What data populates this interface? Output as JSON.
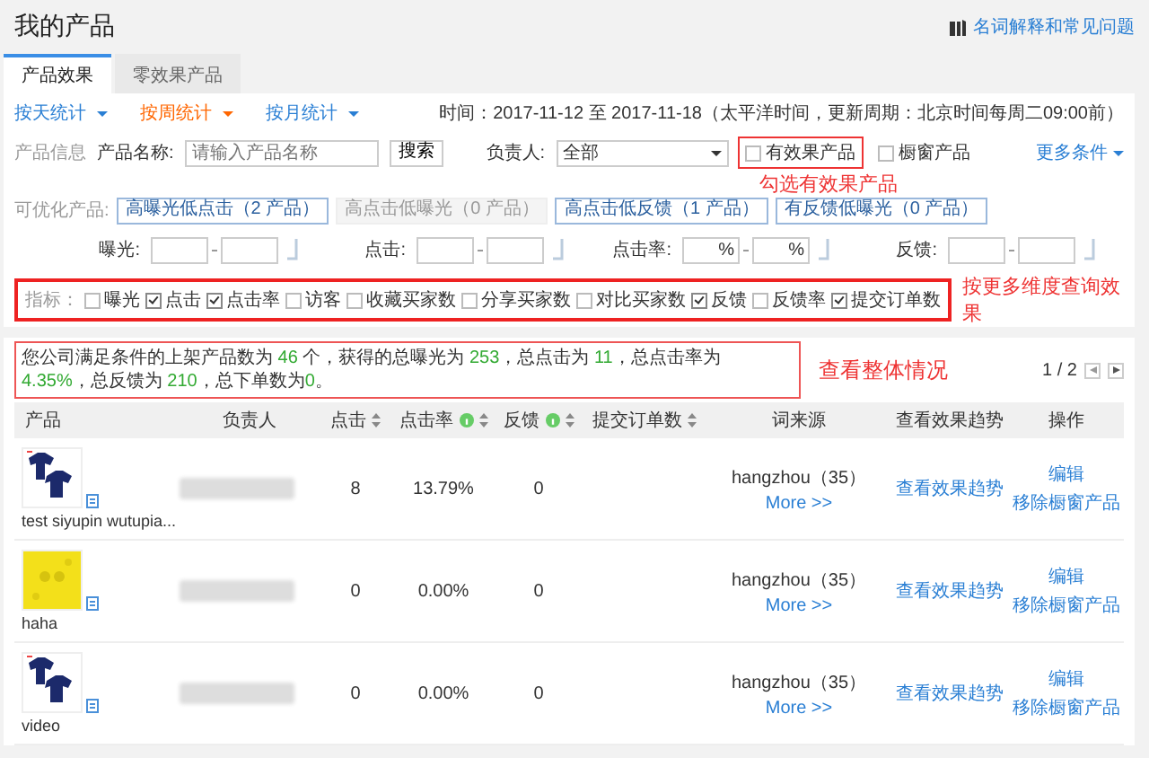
{
  "page_title": "我的产品",
  "help_link": "名词解释和常见问题",
  "tabs": [
    {
      "label": "产品效果",
      "selected": true
    },
    {
      "label": "零效果产品",
      "selected": false
    }
  ],
  "period_links": [
    {
      "label": "按天统计",
      "selected": false
    },
    {
      "label": "按周统计",
      "selected": true
    },
    {
      "label": "按月统计",
      "selected": false
    }
  ],
  "time_range": "时间：2017-11-12 至 2017-11-18（太平洋时间，更新周期：北京时间每周二09:00前）",
  "filter": {
    "section_label": "产品信息",
    "name_label": "产品名称:",
    "name_placeholder": "请输入产品名称",
    "search_button": "搜索",
    "owner_label": "负责人:",
    "owner_value": "全部",
    "checkboxes": [
      {
        "label": "有效果产品",
        "checked": false,
        "highlighted": true
      },
      {
        "label": "橱窗产品",
        "checked": false,
        "highlighted": false
      }
    ],
    "more_link": "更多条件",
    "note": "勾选有效果产品"
  },
  "optimize": {
    "label": "可优化产品:",
    "buttons": [
      {
        "label": "高曝光低点击（2 产品）",
        "disabled": false
      },
      {
        "label": "高点击低曝光（0 产品）",
        "disabled": true
      },
      {
        "label": "高点击低反馈（1 产品）",
        "disabled": false
      },
      {
        "label": "有反馈低曝光（0 产品）",
        "disabled": false
      }
    ]
  },
  "ranges": [
    {
      "label": "曝光:"
    },
    {
      "label": "点击:"
    },
    {
      "label": "点击率:",
      "unit": "%"
    },
    {
      "label": "反馈:"
    }
  ],
  "indicators": {
    "label": "指标：",
    "note": "按更多维度查询效果",
    "items": [
      {
        "label": "曝光",
        "checked": false
      },
      {
        "label": "点击",
        "checked": true
      },
      {
        "label": "点击率",
        "checked": true
      },
      {
        "label": "访客",
        "checked": false
      },
      {
        "label": "收藏买家数",
        "checked": false
      },
      {
        "label": "分享买家数",
        "checked": false
      },
      {
        "label": "对比买家数",
        "checked": false
      },
      {
        "label": "反馈",
        "checked": true
      },
      {
        "label": "反馈率",
        "checked": false
      },
      {
        "label": "提交订单数",
        "checked": true
      }
    ]
  },
  "summary": {
    "note": "查看整体情况",
    "pager": "1 / 2",
    "parts": [
      {
        "text": "您公司满足条件的上架产品数为 ",
        "highlight": false
      },
      {
        "text": "46",
        "highlight": true
      },
      {
        "text": " 个，获得的总曝光为 ",
        "highlight": false
      },
      {
        "text": "253",
        "highlight": true
      },
      {
        "text": "，总点击为 ",
        "highlight": false
      },
      {
        "text": "11",
        "highlight": true
      },
      {
        "text": "，总点击率为 ",
        "highlight": false
      },
      {
        "text": "4.35%",
        "highlight": true
      },
      {
        "text": "，总反馈为 ",
        "highlight": false
      },
      {
        "text": "210",
        "highlight": true
      },
      {
        "text": "，总下单数为",
        "highlight": false
      },
      {
        "text": "0",
        "highlight": true
      },
      {
        "text": "。",
        "highlight": false
      }
    ]
  },
  "table": {
    "columns": [
      {
        "label": "产品",
        "sortable": false,
        "info": false
      },
      {
        "label": "负责人",
        "sortable": false,
        "info": false
      },
      {
        "label": "点击",
        "sortable": true,
        "info": false
      },
      {
        "label": "点击率",
        "sortable": true,
        "info": true
      },
      {
        "label": "反馈",
        "sortable": true,
        "info": true
      },
      {
        "label": "提交订单数",
        "sortable": true,
        "info": false
      },
      {
        "label": "词来源",
        "sortable": false,
        "info": false
      },
      {
        "label": "查看效果趋势",
        "sortable": false,
        "info": false
      },
      {
        "label": "操作",
        "sortable": false,
        "info": false
      }
    ],
    "rows": [
      {
        "kind": "shirts",
        "name": "test siyupin wutupia...",
        "clicks": "8",
        "ctr": "13.79%",
        "feedback": "0",
        "source": "hangzhou（35）",
        "more": "More >>",
        "trend": "查看效果趋势",
        "actions": [
          "编辑",
          "移除橱窗产品"
        ]
      },
      {
        "kind": "yellow",
        "name": "haha",
        "clicks": "0",
        "ctr": "0.00%",
        "feedback": "0",
        "source": "hangzhou（35）",
        "more": "More >>",
        "trend": "查看效果趋势",
        "actions": [
          "编辑",
          "移除橱窗产品"
        ]
      },
      {
        "kind": "shirts",
        "name": "video",
        "clicks": "0",
        "ctr": "0.00%",
        "feedback": "0",
        "source": "hangzhou（35）",
        "more": "More >>",
        "trend": "查看效果趋势",
        "actions": [
          "编辑",
          "移除橱窗产品"
        ]
      }
    ]
  }
}
